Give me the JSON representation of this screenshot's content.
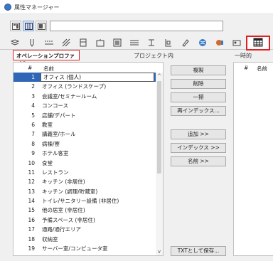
{
  "window": {
    "title": "属性マネージャー"
  },
  "search": {
    "value": ""
  },
  "left": {
    "header_label": "オペレーションプロファイル",
    "col_num": "#",
    "col_name": "名前",
    "items": [
      {
        "n": "1",
        "name": "オフィス (個人)"
      },
      {
        "n": "2",
        "name": "オフィス (ランドスケープ)"
      },
      {
        "n": "3",
        "name": "会議室/セミナールーム"
      },
      {
        "n": "4",
        "name": "コンコース"
      },
      {
        "n": "5",
        "name": "店舗/デパート"
      },
      {
        "n": "6",
        "name": "教室"
      },
      {
        "n": "7",
        "name": "講義室/ホール"
      },
      {
        "n": "8",
        "name": "病棟/寮"
      },
      {
        "n": "9",
        "name": "ホテル客室"
      },
      {
        "n": "10",
        "name": "食堂"
      },
      {
        "n": "11",
        "name": "レストラン"
      },
      {
        "n": "12",
        "name": "キッチン (非居住)"
      },
      {
        "n": "13",
        "name": "キッチン (調理/貯蔵室)"
      },
      {
        "n": "14",
        "name": "トイレ/サニタリー設備 (非居住)"
      },
      {
        "n": "15",
        "name": "他の居室 (非居住)"
      },
      {
        "n": "16",
        "name": "予備スペース (非居住)"
      },
      {
        "n": "17",
        "name": "通路/通行エリア"
      },
      {
        "n": "18",
        "name": "収納室"
      },
      {
        "n": "19",
        "name": "サーバー室/コンピュータ室"
      }
    ]
  },
  "middle": {
    "header_label": "プロジェクト内",
    "buttons": {
      "duplicate": "複製",
      "delete": "削除",
      "purge": "一掃",
      "reindex": "再インデックス...",
      "add": "追加 >>",
      "index": "インデックス >>",
      "name": "名前 >>",
      "save_txt": "TXTとして保存..."
    }
  },
  "right": {
    "header_label": "一時的",
    "col_num": "#",
    "col_name": "名前"
  }
}
